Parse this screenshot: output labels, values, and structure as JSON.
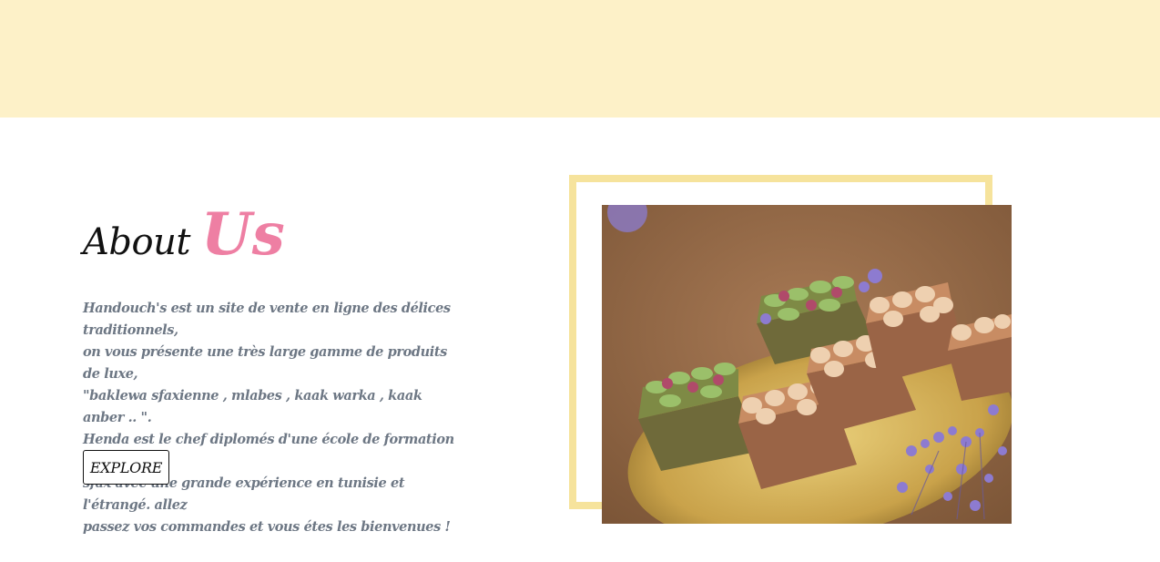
{
  "about": {
    "title_part1": "About",
    "title_part2": "Us",
    "description_lines": [
      "Handouch's est un site de vente en ligne des délices traditionnels,",
      "on vous présente une très large gamme de produits de luxe,",
      "\"baklewa sfaxienne , mlabes , kaak warka , kaak anber .. \".",
      "Henda est le chef diplomés d'une école de formation patisière à",
      "sfax avec une grande expérience en tunisie et l'étrangé. allez",
      "passez vos commandes et vous étes les bienvenues !"
    ],
    "explore_label": "EXPLORE"
  },
  "colors": {
    "top_band": "#fdf1c8",
    "accent_pink": "#ee7fa3",
    "frame_yellow": "#f6e39c",
    "text_gray": "#6d7784"
  },
  "image": {
    "subject": "traditional pastries with pistachio and hazelnut toppings on a golden plate"
  }
}
